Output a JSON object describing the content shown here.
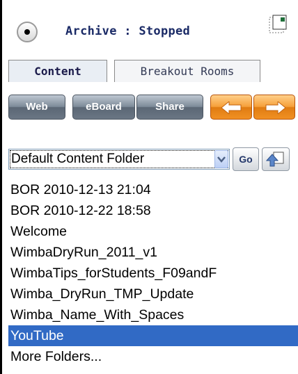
{
  "archive": {
    "status_text": "Archive : Stopped"
  },
  "tabs": [
    {
      "label": "Content",
      "active": true
    },
    {
      "label": "Breakout Rooms",
      "active": false
    }
  ],
  "toolbar": {
    "web_label": "Web",
    "eboard_label": "eBoard",
    "share_label": "Share",
    "prev_icon": "arrow-left-icon",
    "next_icon": "arrow-right-icon"
  },
  "folder_select": {
    "selected": "Default Content Folder",
    "go_label": "Go"
  },
  "folders": [
    {
      "label": "BOR 2010-12-13 21:04",
      "selected": false
    },
    {
      "label": "BOR 2010-12-22 18:58",
      "selected": false
    },
    {
      "label": "Welcome",
      "selected": false
    },
    {
      "label": "WimbaDryRun_2011_v1",
      "selected": false
    },
    {
      "label": "WimbaTips_forStudents_F09andF",
      "selected": false
    },
    {
      "label": "Wimba_DryRun_TMP_Update",
      "selected": false
    },
    {
      "label": "Wimba_Name_With_Spaces",
      "selected": false
    },
    {
      "label": "YouTube",
      "selected": true
    },
    {
      "label": "More Folders...",
      "selected": false
    }
  ],
  "colors": {
    "selection": "#316ac5",
    "orange_button": "#f6a03a",
    "gray_button": "#7e8b99",
    "title_text": "#1a2a66"
  }
}
